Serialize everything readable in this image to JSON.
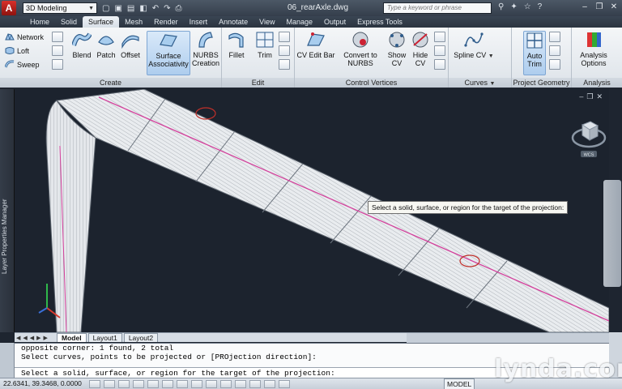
{
  "titlebar": {
    "workspace": "3D Modeling",
    "document_title": "06_rearAxle.dwg",
    "search_placeholder": "Type a keyword or phrase"
  },
  "tabs": [
    "Home",
    "Solid",
    "Surface",
    "Mesh",
    "Render",
    "Insert",
    "Annotate",
    "View",
    "Manage",
    "Output",
    "Express Tools"
  ],
  "active_tab": "Surface",
  "ribbon": {
    "create": {
      "title": "Create",
      "network": "Network",
      "loft": "Loft",
      "sweep": "Sweep",
      "blend": "Blend",
      "patch": "Patch",
      "offset": "Offset",
      "surface_associativity_1": "Surface",
      "surface_associativity_2": "Associativity",
      "nurbs_creation_1": "NURBS",
      "nurbs_creation_2": "Creation"
    },
    "edit": {
      "title": "Edit",
      "fillet": "Fillet",
      "trim": "Trim"
    },
    "control_vertices": {
      "title": "Control Vertices",
      "cv_edit_bar": "CV Edit Bar",
      "convert_1": "Convert to",
      "convert_2": "NURBS",
      "show_1": "Show",
      "show_2": "CV",
      "hide_1": "Hide",
      "hide_2": "CV"
    },
    "curves": {
      "title": "Curves",
      "spline_cv": "Spline CV"
    },
    "project_geometry": {
      "title": "Project Geometry",
      "auto_trim_1": "Auto",
      "auto_trim_2": "Trim"
    },
    "analysis": {
      "title": "Analysis",
      "options_1": "Analysis",
      "options_2": "Options"
    }
  },
  "left_palette": "Layer Properties Manager",
  "viewport": {
    "tooltip": "Select a solid, surface, or region for the target of the projection:",
    "viewcube_label": "WCS"
  },
  "layout_tabs": [
    "Model",
    "Layout1",
    "Layout2"
  ],
  "command": {
    "history": [
      "opposite corner: 1 found, 2 total",
      "Select curves, points to be projected or [PROjection direction]:"
    ],
    "prompt": "Select a solid, surface, or region for the target of the projection:"
  },
  "statusbar": {
    "coords": "22.6341, 39.3468, 0.0000",
    "model": "MODEL"
  },
  "brand": "lynda.com"
}
